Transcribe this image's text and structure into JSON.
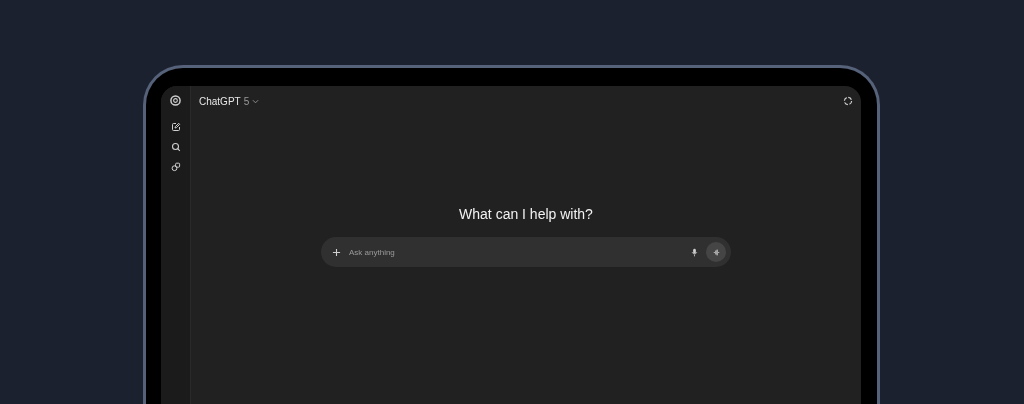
{
  "header": {
    "model_name": "ChatGPT",
    "model_version": "5"
  },
  "heading": "What can I help with?",
  "composer": {
    "placeholder": "Ask anything"
  }
}
